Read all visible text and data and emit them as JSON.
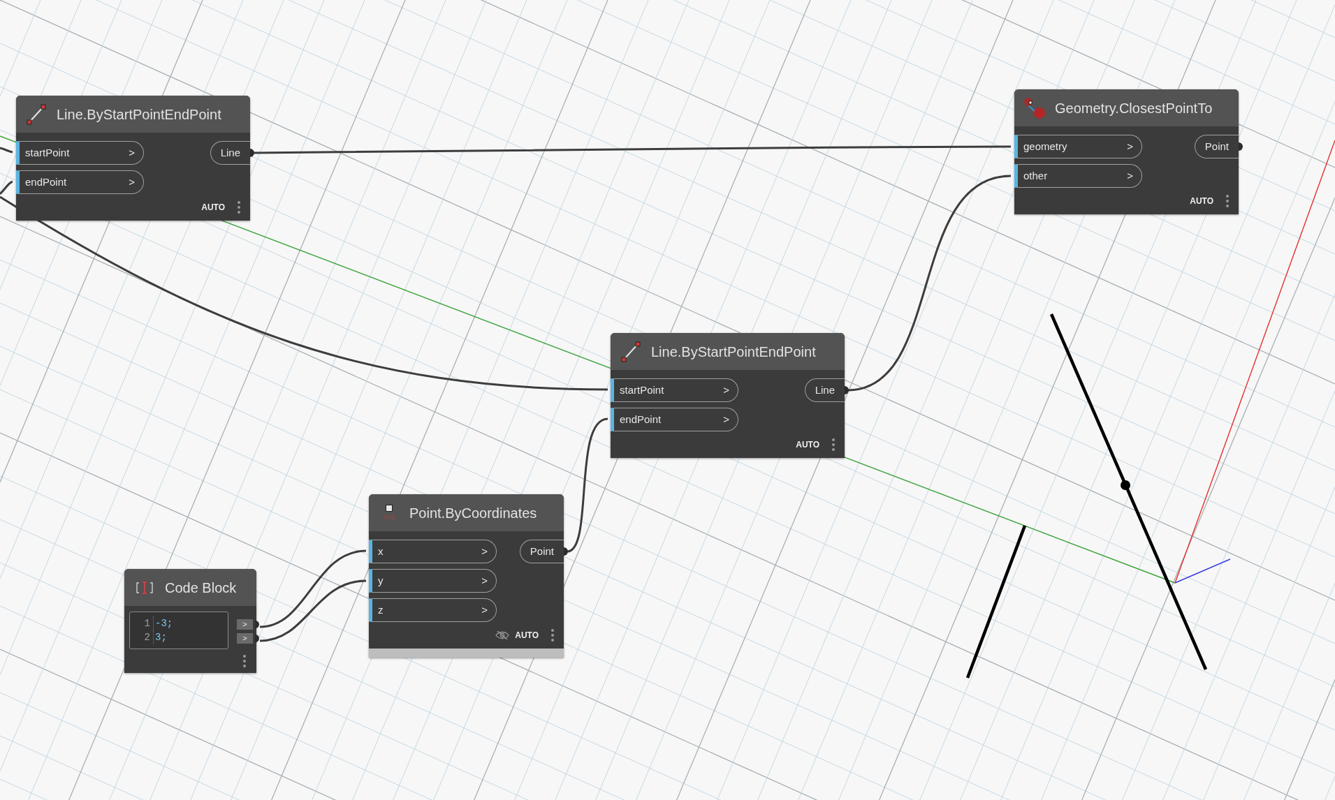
{
  "nodes": [
    {
      "kind": "line",
      "title": "Line.ByStartPointEndPoint",
      "inputs": [
        {
          "label": "startPoint",
          "chevron": ">"
        },
        {
          "label": "endPoint",
          "chevron": ">"
        }
      ],
      "outputs": [
        "Line"
      ],
      "footer": "AUTO"
    },
    {
      "kind": "geometry",
      "title": "Geometry.ClosestPointTo",
      "inputs": [
        {
          "label": "geometry",
          "chevron": ">"
        },
        {
          "label": "other",
          "chevron": ">"
        }
      ],
      "outputs": [
        "Point"
      ],
      "footer": "AUTO"
    },
    {
      "kind": "line",
      "title": "Line.ByStartPointEndPoint",
      "inputs": [
        {
          "label": "startPoint",
          "chevron": ">"
        },
        {
          "label": "endPoint",
          "chevron": ">"
        }
      ],
      "outputs": [
        "Line"
      ],
      "footer": "AUTO"
    },
    {
      "kind": "point",
      "title": "Point.ByCoordinates",
      "icon_text": "XYZ",
      "inputs": [
        {
          "label": "x",
          "chevron": ">"
        },
        {
          "label": "y",
          "chevron": ">"
        },
        {
          "label": "z",
          "chevron": ">"
        }
      ],
      "outputs": [
        "Point"
      ],
      "footer": "AUTO",
      "preview_hidden": true,
      "preview_bar": true
    },
    {
      "kind": "code",
      "title": "Code Block",
      "code_lines": [
        {
          "number": "1",
          "code": "-3;"
        },
        {
          "number": "2",
          "code": "3;"
        }
      ],
      "outputs": [
        ">",
        ">"
      ]
    }
  ]
}
